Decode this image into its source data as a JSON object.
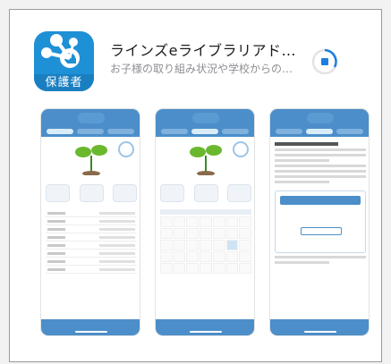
{
  "app": {
    "icon_band_label": "保護者",
    "title": "ラインズeライブラリアドバン…",
    "subtitle": "お子様の取り組み状況や学校からの連絡…",
    "accent_color": "#1e90d6"
  },
  "screenshots": {
    "count": 3
  }
}
